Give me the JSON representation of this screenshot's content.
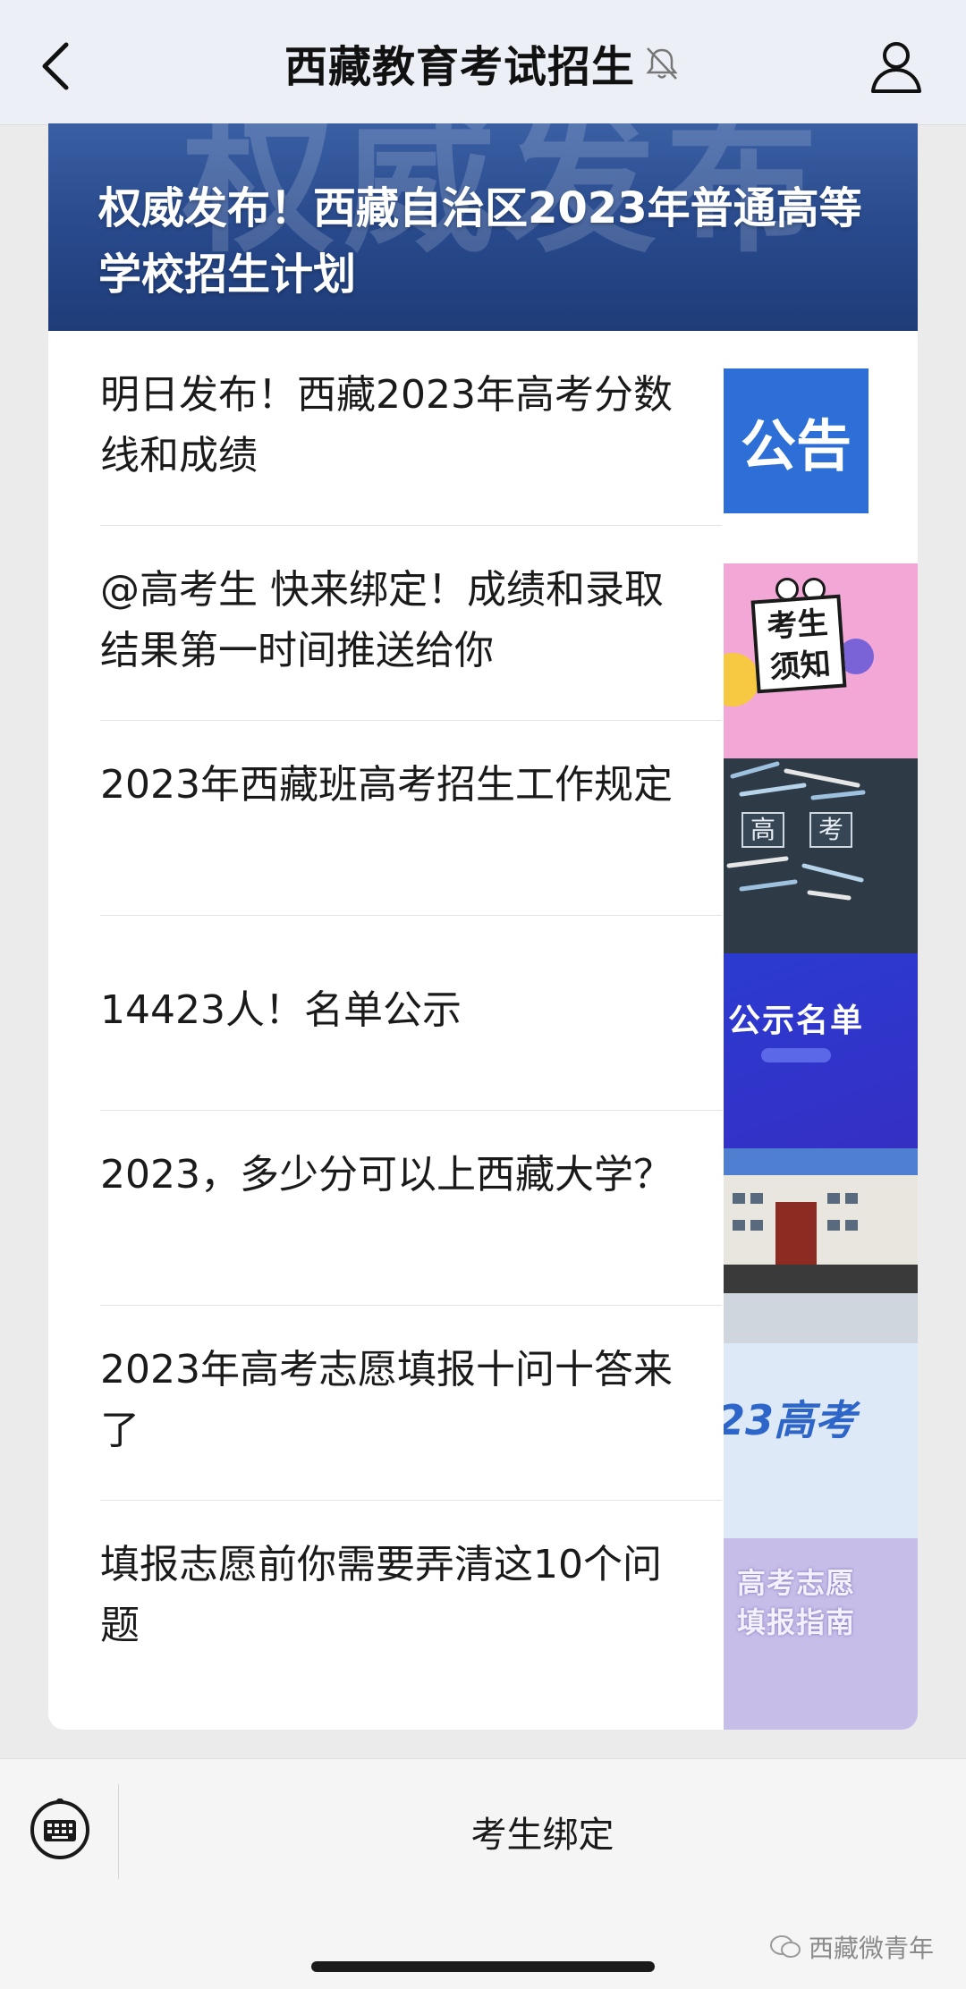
{
  "navbar": {
    "title": "西藏教育考试招生",
    "back_icon": "chevron-left-icon",
    "mute_icon": "bell-muted-icon",
    "profile_icon": "person-icon"
  },
  "banner": {
    "watermark": "权威发布",
    "title": "权威发布！西藏自治区2023年普通高等学校招生计划"
  },
  "articles": [
    {
      "title": "明日发布！西藏2023年高考分数线和成绩",
      "thumb_text": "公告"
    },
    {
      "title": "@高考生 快来绑定！成绩和录取结果第一时间推送给你",
      "thumb_text": "考生须知"
    },
    {
      "title": "2023年西藏班高考招生工作规定",
      "thumb_text_1": "高",
      "thumb_text_2": "考"
    },
    {
      "title": "14423人！名单公示",
      "thumb_text": "公示名单"
    },
    {
      "title": "2023，多少分可以上西藏大学？"
    },
    {
      "title": "2023年高考志愿填报十问十答来了",
      "thumb_text": "23高考"
    },
    {
      "title": "填报志愿前你需要弄清这10个问题",
      "thumb_text": "高考志愿填报指南"
    }
  ],
  "bottom": {
    "keyboard_icon": "keyboard-icon",
    "menu_label": "考生绑定",
    "watermark": "西藏微青年"
  },
  "colors": {
    "banner": "#27488a",
    "notice_thumb": "#2d6fd6",
    "list_thumb": "#2b3bd1"
  }
}
